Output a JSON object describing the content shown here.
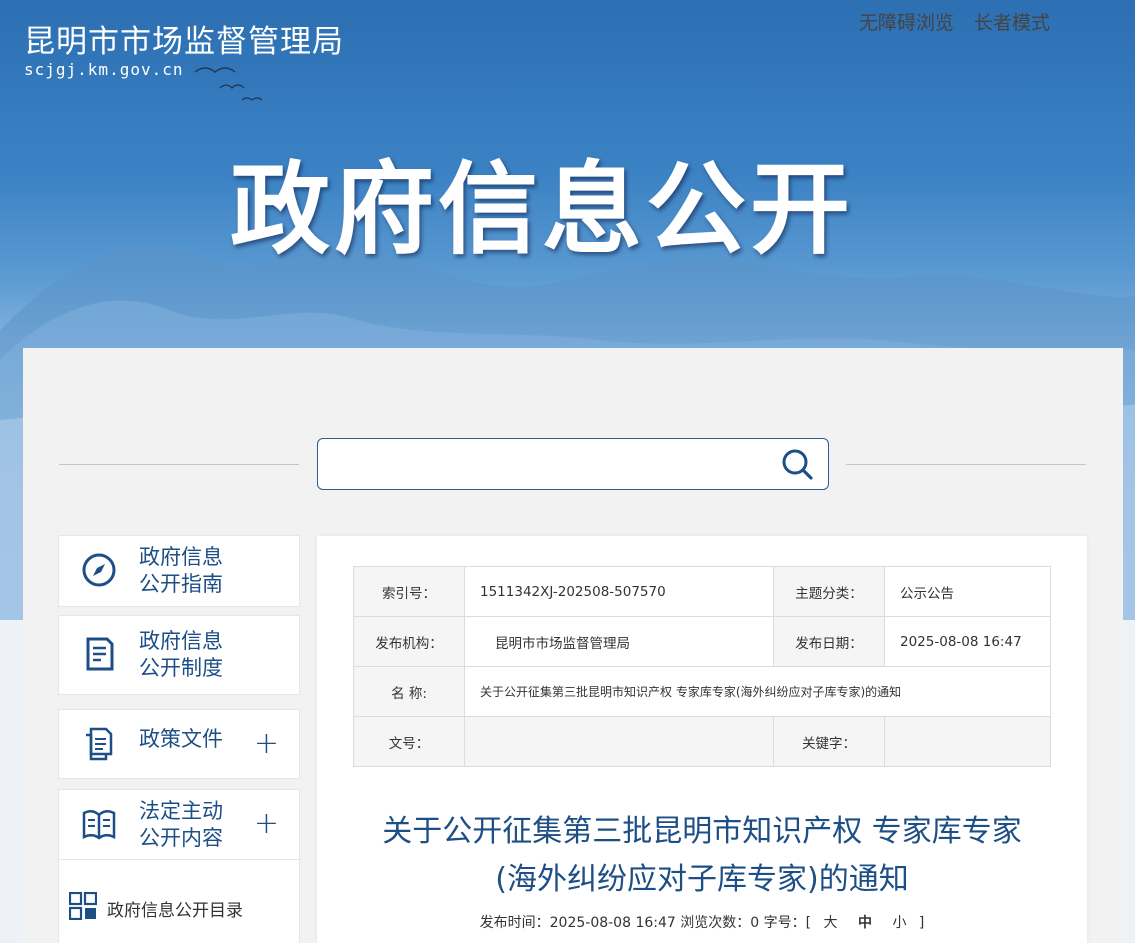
{
  "header": {
    "site_name": "昆明市市场监督管理局",
    "site_domain": "scjgj.km.gov.cn",
    "accessibility_link": "无障碍浏览",
    "elder_mode_link": "长者模式",
    "hero_title": "政府信息公开"
  },
  "search": {
    "placeholder": ""
  },
  "sidebar": {
    "items": [
      {
        "label_line1": "政府信息",
        "label_line2": "公开指南",
        "icon": "compass-icon"
      },
      {
        "label_line1": "政府信息",
        "label_line2": "公开制度",
        "icon": "document-icon"
      },
      {
        "label_line1": "政策文件",
        "label_line2": "",
        "icon": "files-icon",
        "expand": "+"
      },
      {
        "label_line1": "法定主动",
        "label_line2": "公开内容",
        "icon": "book-icon",
        "expand": "+"
      }
    ],
    "sub_item": {
      "label": "政府信息公开目录",
      "icon": "grid-icon"
    }
  },
  "meta": {
    "index_label": "索引号：",
    "index_value": "1511342XJ-202508-507570",
    "topic_label": "主题分类：",
    "topic_value": "公示公告",
    "org_label": "发布机构：",
    "org_value": "昆明市市场监督管理局",
    "date_label": "发布日期：",
    "date_value": "2025-08-08 16:47",
    "name_label": "名  称:",
    "name_value": "关于公开征集第三批昆明市知识产权 专家库专家(海外纠纷应对子库专家)的通知",
    "doc_no_label": "文号：",
    "doc_no_value": "",
    "keyword_label": "关键字：",
    "keyword_value": ""
  },
  "article": {
    "title_line1": "关于公开征集第三批昆明市知识产权 专家库专家",
    "title_line2": "(海外纠纷应对子库专家)的通知",
    "publish_prefix": "发布时间：2025-08-08 16:47 浏览次数：0 字号：[",
    "font_large": "大",
    "font_medium": "中",
    "font_small": "小",
    "publish_suffix": "]"
  },
  "colors": {
    "primary": "#1d4f86",
    "banner_top": "#2c6fb2"
  }
}
